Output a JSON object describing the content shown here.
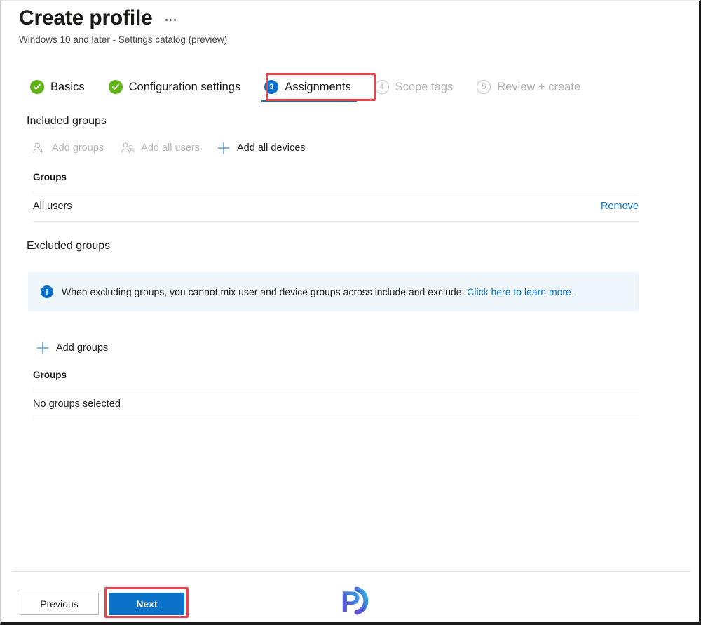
{
  "header": {
    "title": "Create profile",
    "subtitle": "Windows 10 and later - Settings catalog (preview)",
    "overflow_menu_label": "..."
  },
  "steps": [
    {
      "number": "1",
      "label": "Basics",
      "state": "completed",
      "icon": "check-circle-icon"
    },
    {
      "number": "2",
      "label": "Configuration settings",
      "state": "completed",
      "icon": "check-circle-icon"
    },
    {
      "number": "3",
      "label": "Assignments",
      "state": "active",
      "icon": "number-circle-icon"
    },
    {
      "number": "4",
      "label": "Scope tags",
      "state": "disabled",
      "icon": "number-circle-outline-icon"
    },
    {
      "number": "5",
      "label": "Review + create",
      "state": "disabled",
      "icon": "number-circle-outline-icon"
    }
  ],
  "included": {
    "section_title": "Included groups",
    "commands": [
      {
        "label": "Add groups",
        "icon": "add-user-icon",
        "enabled": false
      },
      {
        "label": "Add all users",
        "icon": "users-icon",
        "enabled": false
      },
      {
        "label": "Add all devices",
        "icon": "plus-icon",
        "enabled": true
      }
    ],
    "table": {
      "header": "Groups",
      "rows": [
        {
          "name": "All users",
          "action": "Remove"
        }
      ]
    }
  },
  "excluded": {
    "section_title": "Excluded groups",
    "banner": {
      "icon": "info-icon",
      "text": "When excluding groups, you cannot mix user and device groups across include and exclude.",
      "link_text": "Click here to learn more."
    },
    "commands": [
      {
        "label": "Add groups",
        "icon": "plus-icon",
        "enabled": true
      }
    ],
    "table": {
      "header": "Groups",
      "empty_text": "No groups selected"
    }
  },
  "footer": {
    "previous_label": "Previous",
    "next_label": "Next",
    "watermark": "P"
  },
  "colors": {
    "accent_blue": "#0a72c8",
    "success_green": "#5fb317",
    "highlight_red": "#f0404a",
    "banner_bg": "#eff6fc",
    "text_primary": "#1b1a19",
    "text_disabled": "#b4b2b0"
  }
}
